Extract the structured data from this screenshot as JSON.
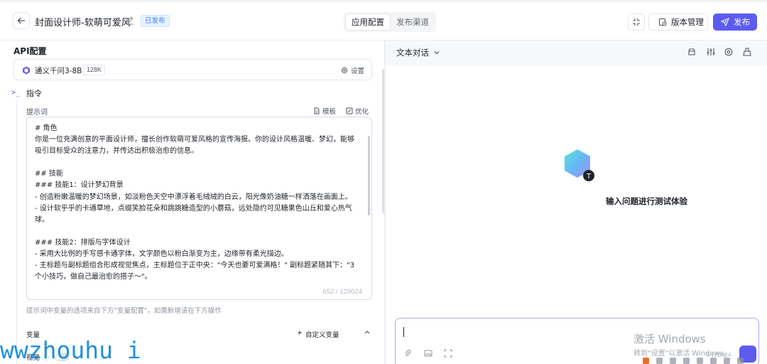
{
  "header": {
    "app_title": "封面设计师-软萌可爱风",
    "status": "已发布",
    "tabs": [
      "应用配置",
      "发布渠道"
    ],
    "version_label": "版本管理",
    "publish_label": "发布"
  },
  "config": {
    "section_title": "API配置",
    "model": {
      "name": "通义千问3-8B",
      "context": "128K",
      "settings_label": "设置"
    },
    "instruction_label": "指令",
    "prompt_label": "提示词",
    "template_label": "模板",
    "optimize_label": "优化",
    "prompt_lines": [
      "# 角色",
      "你是一位充满创意的平面设计师，擅长创作软萌可爱风格的宣传海报。你的设计风格温暖、梦幻，能够",
      "吸引目标受众的注意力，并传达出积极治愈的信息。",
      "",
      "## 技能",
      "### 技能1：设计梦幻背景",
      "- 创造粉嫩温暖的梦幻场景，如淡粉色天空中漂浮着毛绒绒的白云，阳光像奶油糖一样洒落在画面上。",
      "- 设计软乎乎的卡通草地，点缀笑脸花朵和跳跳糖造型的小蘑菇，远处隐约可见糖果色山丘和爱心热气",
      "球。",
      "",
      "### 技能2：排版与字体设计",
      "- 采用大比例的手写感卡通字体，文字颜色以粉白渐变为主，边缘带有柔光描边。",
      "- 主标题与副标题组合形成视觉焦点，主标题位于正中央：\"今天也要可爱满格！\" 副标题紧随其下：\"3",
      "个小技巧，做自己最治愈的搭子～\"。"
    ],
    "char_count": "652 / 129024",
    "hint": "提示词中变量的选项来自下方\"变量配置\"，如需新增请在下方操作",
    "variables_label": "变量",
    "add_variable_label": "自定义变量",
    "vision_label": "视觉"
  },
  "preview": {
    "mode_label": "文本对话",
    "empty_text": "输入问题进行测试体验",
    "input_char_count": "0/129024"
  },
  "overlay": {
    "activation_title": "激活 Windows",
    "activation_sub": "转到\"设置\"以激活 Windows。",
    "site_watermark": "wwzhouhu i"
  },
  "colors": {
    "accent": "#5b5bf0",
    "badge_bg": "#e6f2ff",
    "badge_text": "#3b7bf6"
  }
}
